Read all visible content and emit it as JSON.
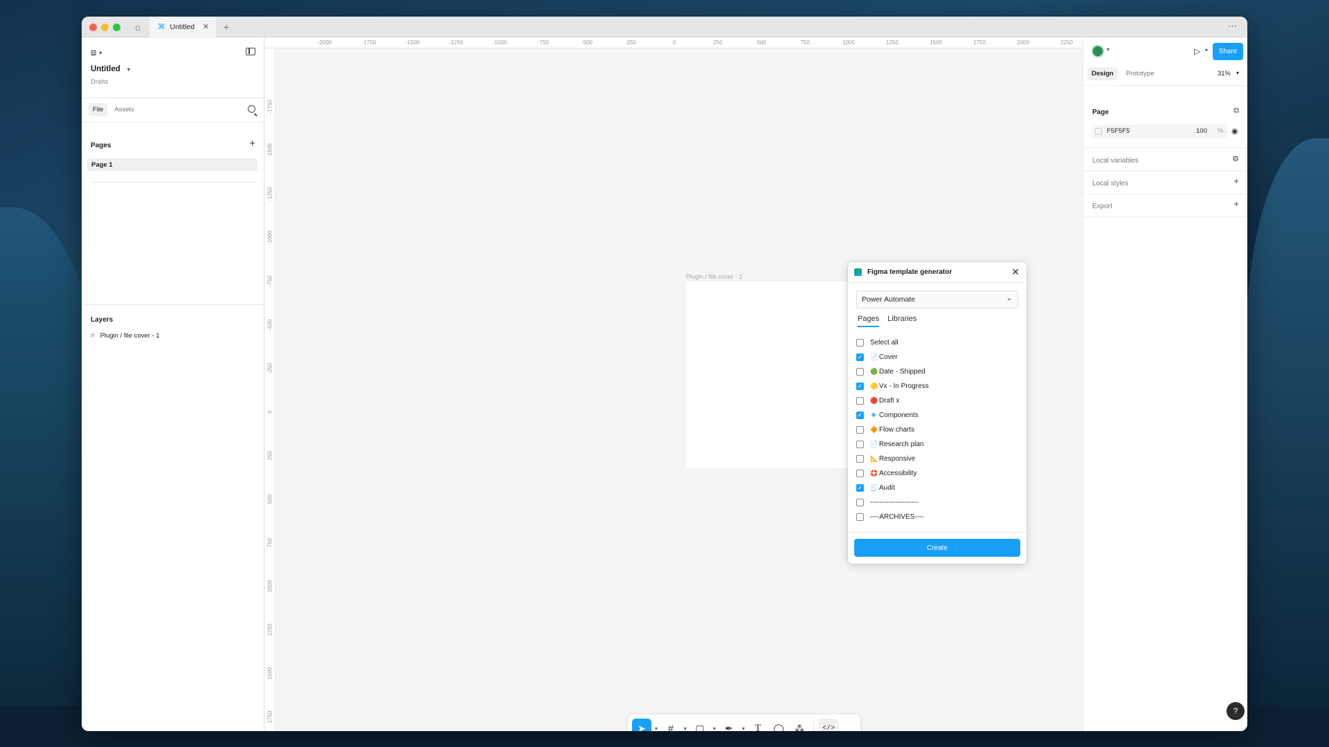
{
  "window": {
    "tab_title": "Untitled",
    "new_tab_symbol": "+",
    "more_symbol": "⋯"
  },
  "left_panel": {
    "file_name": "Untitled",
    "location": "Drafts",
    "segments": [
      "File",
      "Assets"
    ],
    "pages_heading": "Pages",
    "pages": [
      "Page 1"
    ],
    "layers_heading": "Layers",
    "layers": [
      "Plugin / file cover - 1"
    ]
  },
  "canvas": {
    "ruler_top": [
      "-2000",
      "-1750",
      "-1500",
      "-1250",
      "-1000",
      "-750",
      "-500",
      "-250",
      "0",
      "250",
      "500",
      "750",
      "1000",
      "1250",
      "1500",
      "1750",
      "2000",
      "2250"
    ],
    "ruler_left": [
      "-1750",
      "-1500",
      "-1250",
      "-1000",
      "-750",
      "-500",
      "-250",
      "0",
      "250",
      "500",
      "750",
      "1000",
      "1250",
      "1500",
      "1750"
    ],
    "frame_label": "Plugin / file cover - 1"
  },
  "plugin": {
    "title": "Figma template generator",
    "dropdown_value": "Power Automate",
    "tabs": [
      "Pages",
      "Libraries"
    ],
    "active_tab": "Pages",
    "items": [
      {
        "label": "Select all",
        "checked": false,
        "emoji": ""
      },
      {
        "label": "Cover",
        "checked": true,
        "emoji": "📄"
      },
      {
        "label": "Date - Shipped",
        "checked": false,
        "emoji": "🟢"
      },
      {
        "label": "Vx - In Progress",
        "checked": true,
        "emoji": "🟡"
      },
      {
        "label": "Draft x",
        "checked": false,
        "emoji": "🔴"
      },
      {
        "label": "Components",
        "checked": true,
        "emoji": "❖"
      },
      {
        "label": "Flow charts",
        "checked": false,
        "emoji": "🔶"
      },
      {
        "label": "Research plan",
        "checked": false,
        "emoji": "📄"
      },
      {
        "label": "Responsive",
        "checked": false,
        "emoji": "📐"
      },
      {
        "label": "Accessibility",
        "checked": false,
        "emoji": "🛟"
      },
      {
        "label": "Audit",
        "checked": true,
        "emoji": "🧾"
      },
      {
        "label": "---------------------",
        "checked": false,
        "emoji": ""
      },
      {
        "label": "----ARCHIVES----",
        "checked": false,
        "emoji": ""
      }
    ],
    "create_label": "Create"
  },
  "right_panel": {
    "share_label": "Share",
    "tabs": [
      "Design",
      "Prototype"
    ],
    "zoom": "31%",
    "page_heading": "Page",
    "page_color_hex": "F5F5F5",
    "page_opacity": "100",
    "page_opacity_unit": "%",
    "local_variables": "Local variables",
    "local_styles": "Local styles",
    "export": "Export",
    "help_symbol": "?"
  },
  "colors": {
    "accent": "#18a0fb",
    "canvas": "#f5f5f5"
  }
}
